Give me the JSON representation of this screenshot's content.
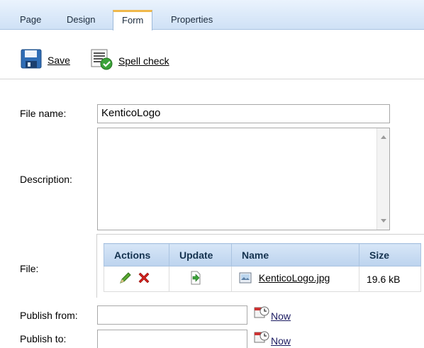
{
  "tabs": [
    {
      "label": "Page"
    },
    {
      "label": "Design"
    },
    {
      "label": "Form"
    },
    {
      "label": "Properties"
    }
  ],
  "toolbar": {
    "save_label": "Save",
    "spellcheck_label": "Spell check"
  },
  "form": {
    "filename_label": "File name:",
    "filename_value": "KenticoLogo",
    "description_label": "Description:",
    "description_value": "",
    "file_label": "File:",
    "publish_from_label": "Publish from:",
    "publish_from_value": "",
    "publish_to_label": "Publish to:",
    "publish_to_value": "",
    "now_label": "Now"
  },
  "file_table": {
    "headers": [
      "Actions",
      "Update",
      "Name",
      "Size"
    ],
    "row": {
      "name": "KenticoLogo.jpg",
      "size": "19.6 kB"
    }
  },
  "colors": {
    "tab_active_accent": "#f0b84a",
    "grid_header": "#c9dcf2"
  }
}
